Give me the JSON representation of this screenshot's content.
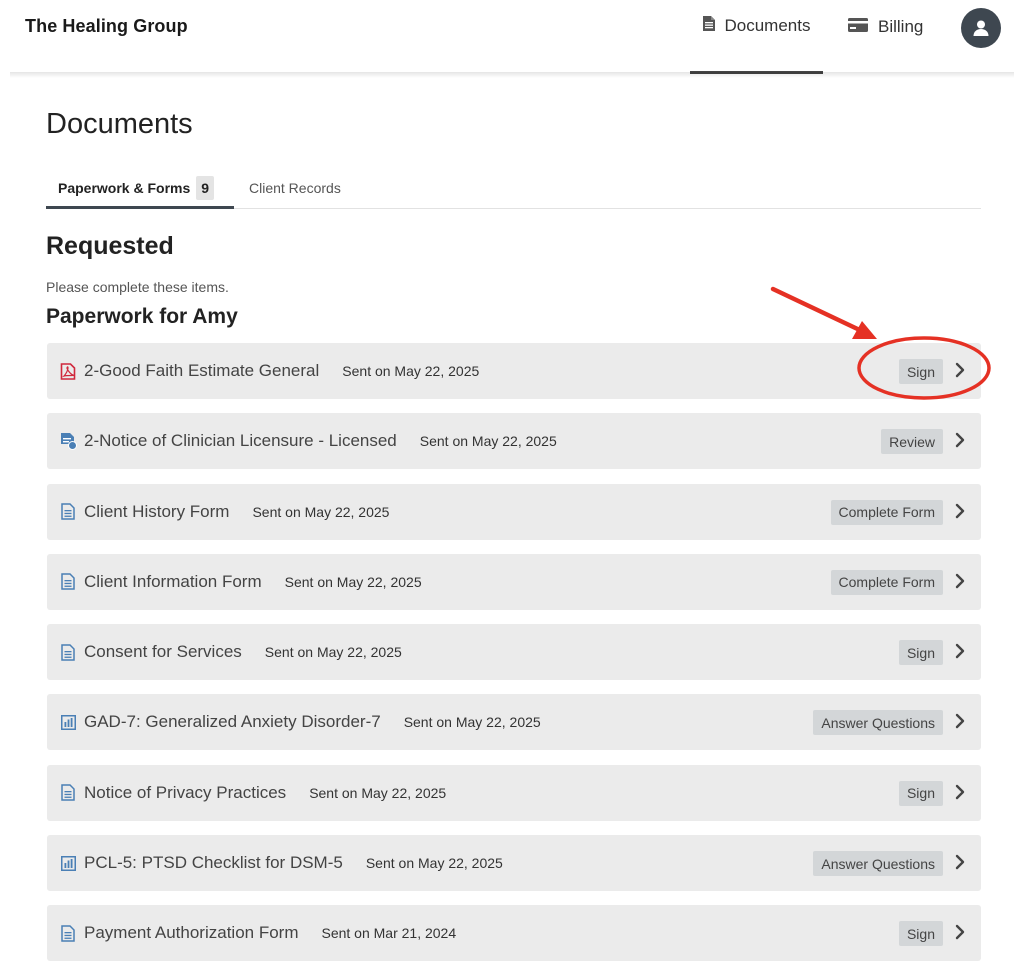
{
  "header": {
    "brand": "The Healing Group",
    "nav": {
      "documents_label": "Documents",
      "billing_label": "Billing"
    }
  },
  "page": {
    "title": "Documents",
    "tabs": [
      {
        "label": "Paperwork & Forms",
        "count": "9",
        "active": true
      },
      {
        "label": "Client Records",
        "active": false
      }
    ],
    "section_title": "Requested",
    "hint": "Please complete these items.",
    "group_title": "Paperwork for Amy"
  },
  "documents": [
    {
      "name": "2-Good Faith Estimate General",
      "sent": "Sent on May 22, 2025",
      "action": "Sign",
      "icon": "pdf-icon"
    },
    {
      "name": "2-Notice of Clinician Licensure - Licensed",
      "sent": "Sent on May 22, 2025",
      "action": "Review",
      "icon": "document-badge-icon"
    },
    {
      "name": "Client History Form",
      "sent": "Sent on May 22, 2025",
      "action": "Complete Form",
      "icon": "form-icon"
    },
    {
      "name": "Client Information Form",
      "sent": "Sent on May 22, 2025",
      "action": "Complete Form",
      "icon": "form-icon"
    },
    {
      "name": "Consent for Services",
      "sent": "Sent on May 22, 2025",
      "action": "Sign",
      "icon": "form-icon"
    },
    {
      "name": "GAD-7: Generalized Anxiety Disorder-7",
      "sent": "Sent on May 22, 2025",
      "action": "Answer Questions",
      "icon": "chart-icon"
    },
    {
      "name": "Notice of Privacy Practices",
      "sent": "Sent on May 22, 2025",
      "action": "Sign",
      "icon": "form-icon"
    },
    {
      "name": "PCL-5: PTSD Checklist for DSM-5",
      "sent": "Sent on May 22, 2025",
      "action": "Answer Questions",
      "icon": "chart-icon"
    },
    {
      "name": "Payment Authorization Form",
      "sent": "Sent on Mar 21, 2024",
      "action": "Sign",
      "icon": "form-icon"
    }
  ],
  "colors": {
    "accent_dark": "#3e4750",
    "row_bg": "#ebebeb",
    "pdf_red": "#d0283c",
    "icon_blue": "#4a7fb5",
    "annotation_red": "#e53124"
  }
}
